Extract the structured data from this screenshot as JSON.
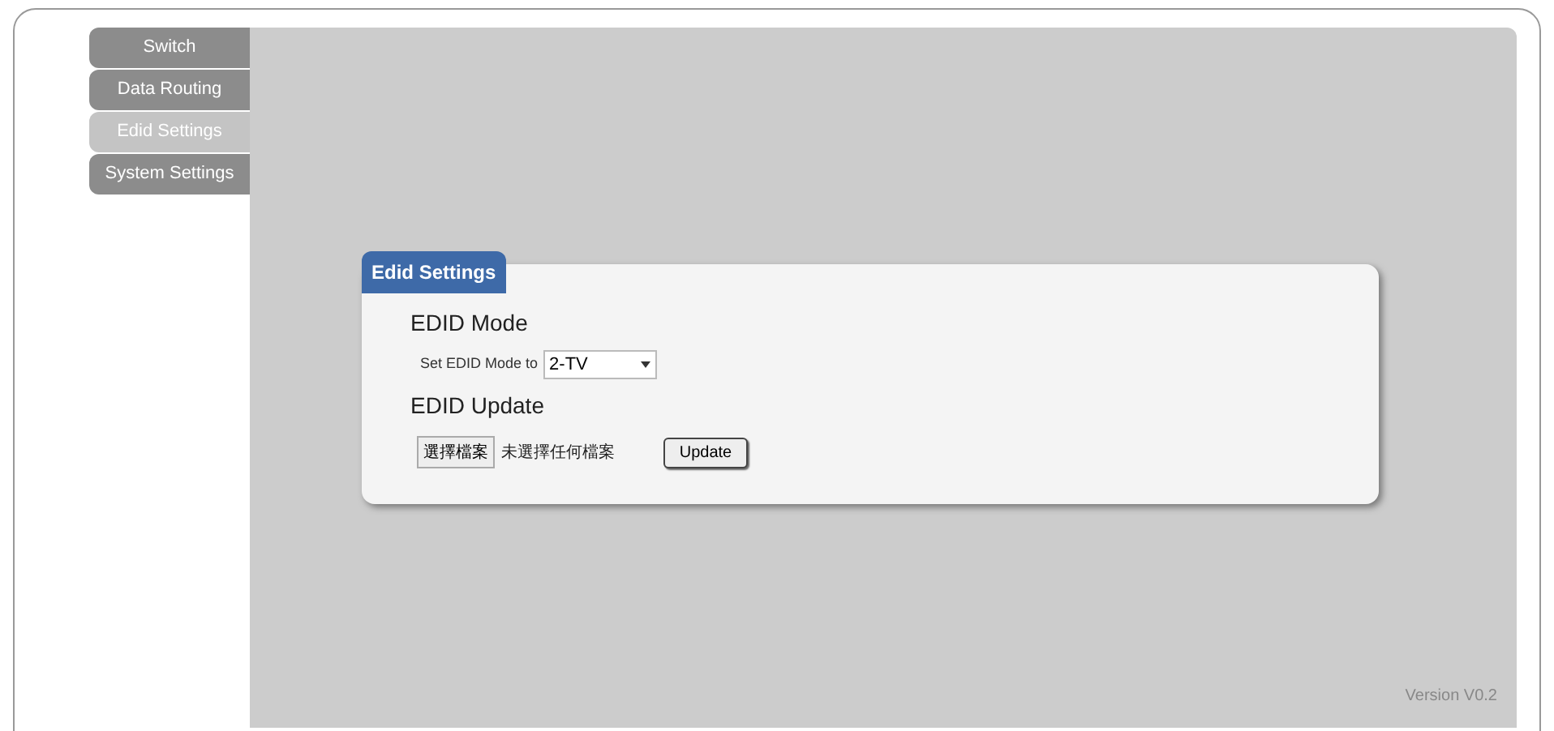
{
  "sidebar": {
    "items": [
      {
        "label": "Switch",
        "selected": false
      },
      {
        "label": "Data Routing",
        "selected": false
      },
      {
        "label": "Edid Settings",
        "selected": true
      },
      {
        "label": "System Settings",
        "selected": false
      }
    ]
  },
  "panel": {
    "title": "Edid Settings",
    "mode_heading": "EDID Mode",
    "mode_label": "Set EDID Mode to",
    "mode_value": "2-TV",
    "update_heading": "EDID Update",
    "file_button": "選擇檔案",
    "file_status": "未選擇任何檔案",
    "update_button": "Update"
  },
  "version": "Version V0.2"
}
